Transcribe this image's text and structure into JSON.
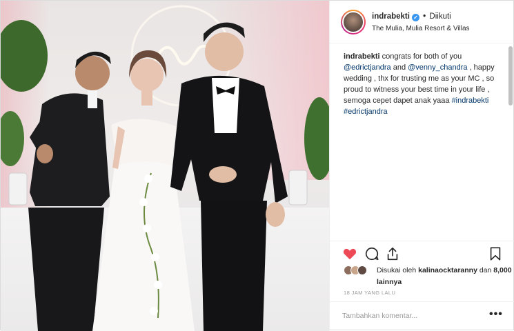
{
  "post": {
    "username": "indrabekti",
    "follow_status": "Diikuti",
    "separator": "•",
    "location": "The Mulia, Mulia Resort & Villas"
  },
  "caption": {
    "username": "indrabekti",
    "text_1": " congrats for both of you ",
    "mention_1": "@edrictjandra",
    "text_2": " and ",
    "mention_2": "@venny_chandra",
    "text_3": " , happy wedding , thx for trusting me as your MC , so proud to witness your best time in your life , semoga cepet dapet anak yaaa ",
    "hashtag_1": "#indrabekti",
    "hashtag_2": "#edrictjandra"
  },
  "likes": {
    "prefix": "Disukai oleh ",
    "user": "kalinaocktaranny",
    "middle": " dan ",
    "count": "8,000 lainnya"
  },
  "timestamp": "18 JAM YANG LALU",
  "comment_box": {
    "placeholder": "Tambahkan komentar...",
    "more": "•••"
  },
  "colors": {
    "like_red": "#ed4956",
    "link_blue": "#003569",
    "verified_blue": "#3897f0"
  }
}
